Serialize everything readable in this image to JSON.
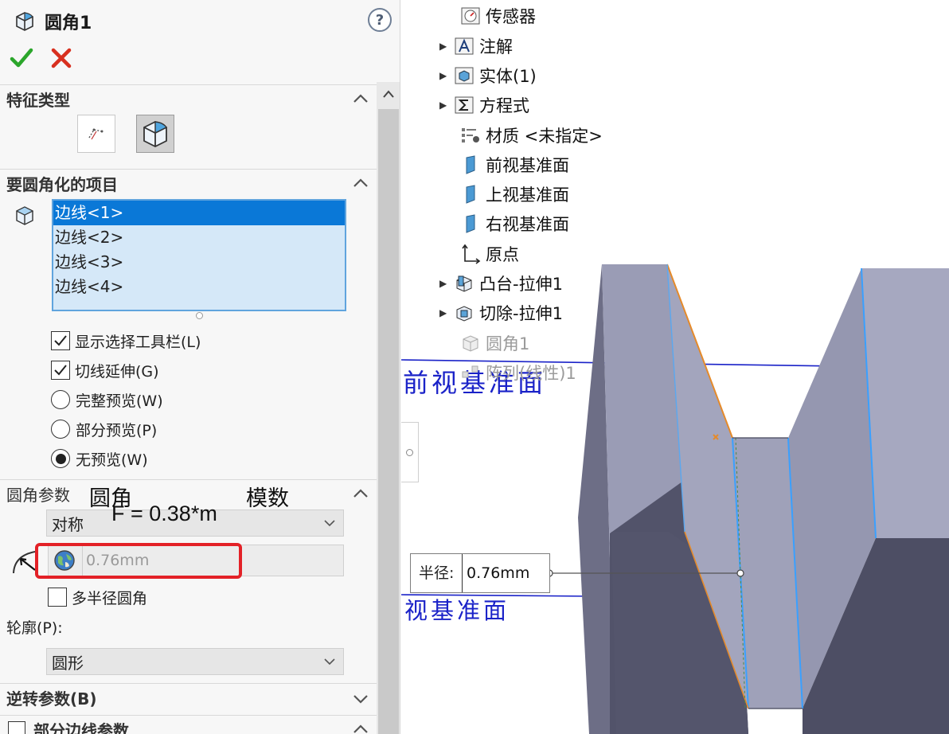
{
  "panel": {
    "title": "圆角1",
    "help_label": "?",
    "sections": {
      "feature_type": "特征类型",
      "items_to_fillet": "要圆角化的项目",
      "fillet_params": "圆角参数",
      "reverse_params": "逆转参数(B)",
      "partial_edge_params": "部分边线参数"
    },
    "edges": [
      "边线<1>",
      "边线<2>",
      "边线<3>",
      "边线<4>"
    ],
    "options": {
      "show_selection_toolbar": "显示选择工具栏(L)",
      "tangent_propagation": "切线延伸(G)",
      "full_preview": "完整预览(W)",
      "partial_preview": "部分预览(P)",
      "no_preview": "无预览(W)"
    },
    "fillet_method": "对称",
    "radius_value": "0.76mm",
    "multi_radius": "多半径圆角",
    "profile_label": "轮廓(P):",
    "profile_value": "圆形"
  },
  "annotations": {
    "fillet": "圆角",
    "module": "模数",
    "formula": "F = 0.38*m"
  },
  "tree": {
    "items": [
      {
        "label": "传感器",
        "icon": "sensor-folder-icon"
      },
      {
        "label": "注解",
        "icon": "annotation-folder-icon"
      },
      {
        "label": "实体(1)",
        "icon": "solid-body-folder-icon"
      },
      {
        "label": "方程式",
        "icon": "equation-folder-icon"
      },
      {
        "label": "材质 <未指定>",
        "icon": "material-icon"
      },
      {
        "label": "前视基准面",
        "icon": "plane-icon"
      },
      {
        "label": "上视基准面",
        "icon": "plane-icon"
      },
      {
        "label": "右视基准面",
        "icon": "plane-icon"
      },
      {
        "label": "原点",
        "icon": "origin-icon"
      },
      {
        "label": "凸台-拉伸1",
        "icon": "boss-extrude-icon"
      },
      {
        "label": "切除-拉伸1",
        "icon": "cut-extrude-icon"
      },
      {
        "label": "圆角1",
        "icon": "fillet-icon"
      },
      {
        "label": "阵列(线性)1",
        "icon": "linear-pattern-icon"
      }
    ]
  },
  "viewport": {
    "plane_label_front": "前视基准面",
    "plane_label_front_lower": "视基准面",
    "callout_label": "半径:",
    "callout_value": "0.76mm"
  },
  "colors": {
    "accent": "#0a78d7",
    "highlight_box": "#e32127",
    "plane_line": "#1a22c8"
  }
}
